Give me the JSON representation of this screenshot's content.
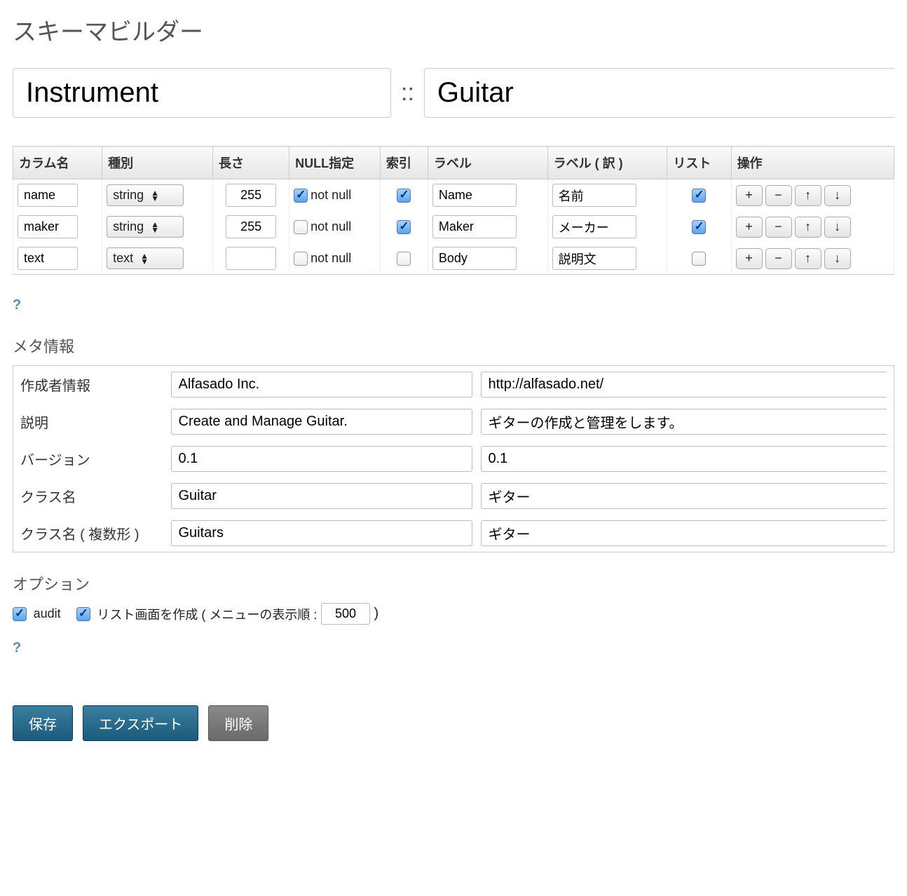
{
  "title": "スキーマビルダー",
  "top": {
    "namespace": "Instrument",
    "separator": "::",
    "class": "Guitar"
  },
  "table": {
    "headers": {
      "col": "カラム名",
      "type": "種別",
      "len": "長さ",
      "null": "NULL指定",
      "index": "索引",
      "label": "ラベル",
      "label_t": "ラベル ( 訳 )",
      "list": "リスト",
      "ops": "操作"
    },
    "notnull_label": "not null",
    "op_plus": "+",
    "op_minus": "−",
    "op_up": "↑",
    "op_down": "↓",
    "rows": [
      {
        "col": "name",
        "type": "string",
        "len": "255",
        "nn": true,
        "idx": true,
        "label": "Name",
        "label_t": "名前",
        "list": true
      },
      {
        "col": "maker",
        "type": "string",
        "len": "255",
        "nn": false,
        "idx": true,
        "label": "Maker",
        "label_t": "メーカー",
        "list": true
      },
      {
        "col": "text",
        "type": "text",
        "len": "",
        "nn": false,
        "idx": false,
        "label": "Body",
        "label_t": "説明文",
        "list": false
      }
    ]
  },
  "help_icon": "?",
  "meta": {
    "heading": "メタ情報",
    "rows": {
      "author": {
        "label": "作成者情報",
        "a": "Alfasado Inc.",
        "b": "http://alfasado.net/"
      },
      "desc": {
        "label": "説明",
        "a": "Create and Manage Guitar.",
        "b": "ギターの作成と管理をします。"
      },
      "version": {
        "label": "バージョン",
        "a": "0.1",
        "b": "0.1"
      },
      "cls": {
        "label": "クラス名",
        "a": "Guitar",
        "b": "ギター"
      },
      "cls_pl": {
        "label": "クラス名 ( 複数形 )",
        "a": "Guitars",
        "b": "ギター"
      }
    }
  },
  "options": {
    "heading": "オプション",
    "audit_label": "audit",
    "audit_checked": true,
    "list_label": "リスト画面を作成 ( メニューの表示順 :",
    "list_checked": true,
    "order": "500",
    "close": ")"
  },
  "buttons": {
    "save": "保存",
    "export": "エクスポート",
    "delete": "削除"
  }
}
